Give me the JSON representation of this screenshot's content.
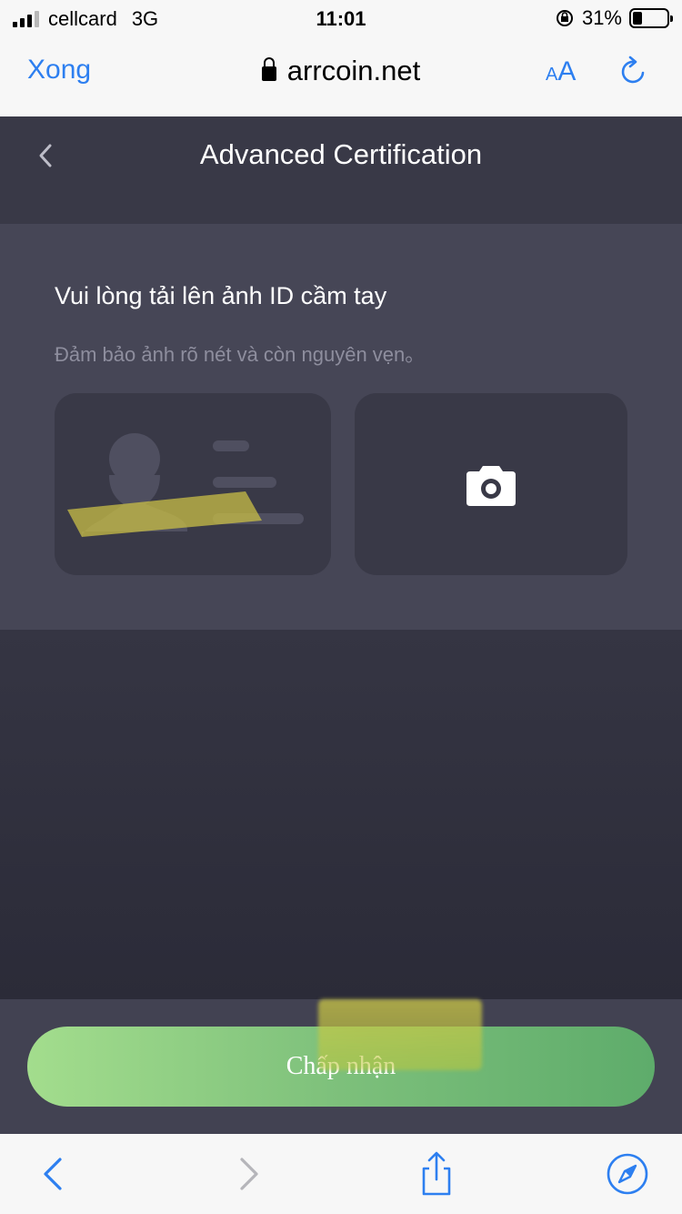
{
  "status_bar": {
    "carrier": "cellcard",
    "network": "3G",
    "time": "11:01",
    "battery": "31%"
  },
  "browser": {
    "done_label": "Xong",
    "url": "arrcoin.net",
    "text_size_label_small": "A",
    "text_size_label_big": "A",
    "accent_color": "#2d7ff0"
  },
  "header": {
    "title": "Advanced Certification"
  },
  "upload": {
    "title": "Vui lòng tải lên ảnh ID cầm tay",
    "subtitle": "Đảm bảo ảnh rõ nét và còn nguyên vẹn。"
  },
  "actions": {
    "accept_label": "Chấp nhận"
  },
  "icons": {
    "back": "chevron-left-icon",
    "camera": "camera-icon",
    "reload": "reload-icon",
    "lock": "lock-icon",
    "share": "share-icon",
    "compass": "compass-icon"
  }
}
